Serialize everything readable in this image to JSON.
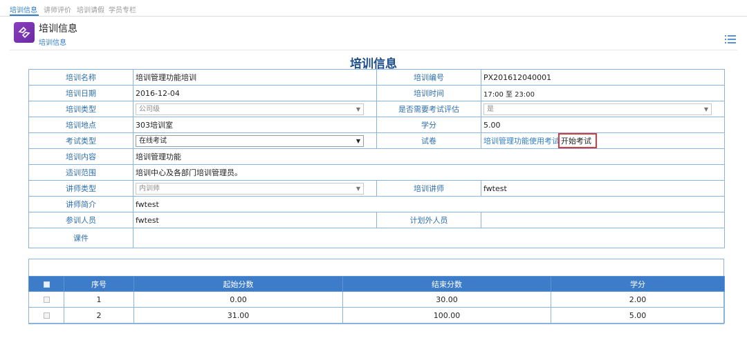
{
  "tabs": [
    "培训信息",
    "讲师评价",
    "培训请假",
    "学员专栏"
  ],
  "header": {
    "title": "培训信息",
    "breadcrumb": "培训信息"
  },
  "form_title": "培训信息",
  "info": {
    "name_label": "培训名称",
    "name": "培训管理功能培训",
    "code_label": "培训编号",
    "code": "PX201612040001",
    "date_label": "培训日期",
    "date": "2016-12-04",
    "time_label": "培训时间",
    "time": "17:00 至 23:00",
    "type_label": "培训类型",
    "type": "公司级",
    "exam_eval_label": "是否需要考试评估",
    "exam_eval": "是",
    "location_label": "培训地点",
    "location": "303培训室",
    "credit_label": "学分",
    "credit": "5.00",
    "exam_type_label": "考试类型",
    "exam_type": "在线考试",
    "paper_label": "试卷",
    "paper": "培训管理功能使用考试",
    "start_exam": "开始考试",
    "content_label": "培训内容",
    "content": "培训管理功能",
    "scope_label": "适训范围",
    "scope": "培训中心及各部门培训管理员。",
    "lecturer_type_label": "讲师类型",
    "lecturer_type": "内训师",
    "lecturer_label": "培训讲师",
    "lecturer": "fwtest",
    "lecturer_intro_label": "讲师简介",
    "lecturer_intro": "fwtest",
    "participants_label": "参训人员",
    "participants": "fwtest",
    "unplanned_label": "计划外人员",
    "unplanned": "",
    "courseware_label": "课件",
    "courseware": ""
  },
  "score_table": {
    "headers": [
      "序号",
      "起始分数",
      "结束分数",
      "学分"
    ],
    "rows": [
      {
        "no": "1",
        "start": "0.00",
        "end": "30.00",
        "credit": "2.00"
      },
      {
        "no": "2",
        "start": "31.00",
        "end": "100.00",
        "credit": "5.00"
      }
    ]
  }
}
